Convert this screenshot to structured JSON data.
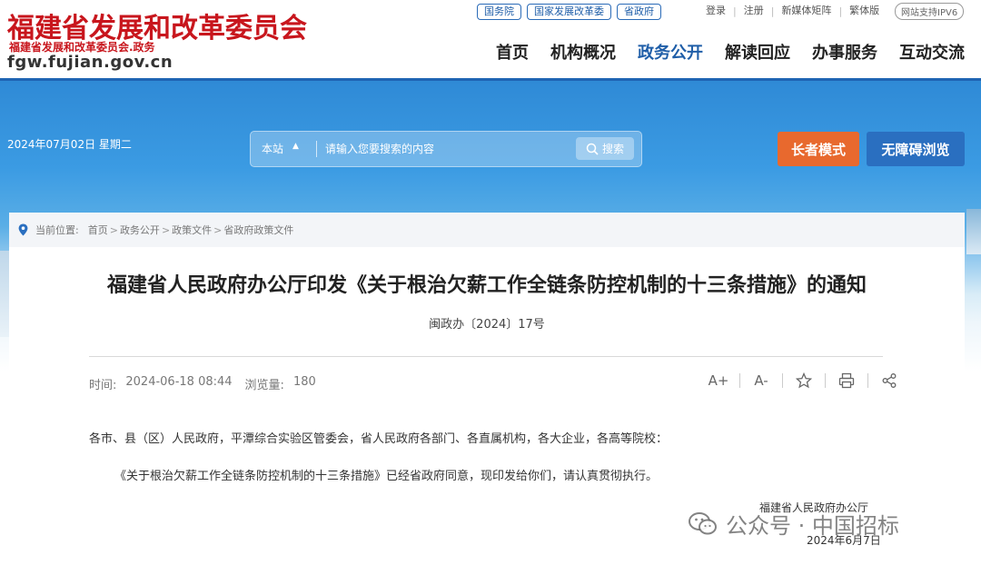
{
  "header": {
    "logo_title": "福建省发展和改革委员会",
    "logo_subtitle": "福建省发展和改革委员会.政务",
    "logo_url": "fgw.fujian.gov.cn",
    "top_links": [
      "国务院",
      "国家发展改革委",
      "省政府"
    ],
    "user_links": [
      "登录",
      "注册",
      "新媒体矩阵",
      "繁体版"
    ],
    "ipv6_badge": "网站支持IPV6",
    "nav": [
      "首页",
      "机构概况",
      "政务公开",
      "解读回应",
      "办事服务",
      "互动交流"
    ],
    "active_nav": "政务公开"
  },
  "banner": {
    "date": "2024年07月02日 星期二",
    "search": {
      "scope": "本站",
      "placeholder": "请输入您要搜索的内容",
      "button": "搜索"
    },
    "elder_mode": "长者模式",
    "accessible_mode": "无障碍浏览"
  },
  "breadcrumb": {
    "label": "当前位置:",
    "items": [
      "首页",
      "政务公开",
      "政策文件",
      "省政府政策文件"
    ]
  },
  "article": {
    "title": "福建省人民政府办公厅印发《关于根治欠薪工作全链条防控机制的十三条措施》的通知",
    "doc_number": "闽政办〔2024〕17号",
    "time_label": "时间:",
    "time_value": "2024-06-18 08:44",
    "views_label": "浏览量:",
    "views_value": "180",
    "tools": [
      "A+",
      "A-"
    ],
    "salutation": "各市、县（区）人民政府，平潭综合实验区管委会，省人民政府各部门、各直属机构，各大企业，各高等院校：",
    "body": "《关于根治欠薪工作全链条防控机制的十三条措施》已经省政府同意，现印发给你们，请认真贯彻执行。",
    "signature": "福建省人民政府办公厅",
    "sign_date": "2024年6月7日"
  },
  "watermark": "公众号 · 中国招标",
  "colors": {
    "brand_red": "#c8161d",
    "nav_blue": "#1f5ea8",
    "elder_orange": "#e8692e",
    "access_blue": "#2a6fc0"
  }
}
